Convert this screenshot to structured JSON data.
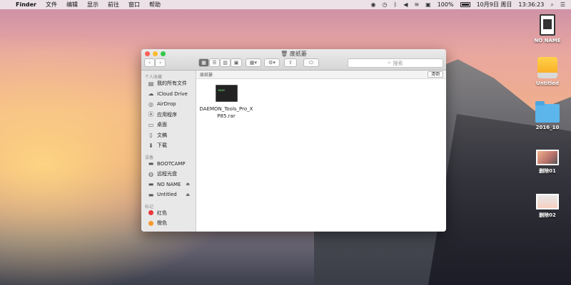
{
  "menubar": {
    "apple": "",
    "app_name": "Finder",
    "menus": [
      "文件",
      "编辑",
      "显示",
      "前往",
      "窗口",
      "帮助"
    ],
    "battery_pct": "100%",
    "date": "10月9日 周日",
    "time": "13:36:23"
  },
  "desktop": {
    "items": [
      "NO NAME",
      "Untitled",
      "2016_10",
      "删除01",
      "删除02"
    ]
  },
  "window": {
    "title": "废纸篓",
    "search_placeholder": "搜索",
    "path_label": "废纸篓",
    "clear_label": "清倒",
    "sidebar": {
      "favorites_header": "个人收藏",
      "favorites": [
        "我的所有文件",
        "iCloud Drive",
        "AirDrop",
        "应用程序",
        "桌面",
        "文稿",
        "下载"
      ],
      "devices_header": "设备",
      "devices": [
        "BOOTCAMP",
        "远程光盘",
        "NO NAME",
        "Untitled"
      ],
      "tags_header": "标记",
      "tags": [
        "红色",
        "橙色"
      ]
    },
    "file": {
      "name": "DAEMON_Tools_Pro_XP85.rar",
      "thumb_text": "exec"
    }
  },
  "colors": {
    "close": "#fc5f57",
    "minimize": "#fdbc2e",
    "zoom": "#34c84a",
    "tag_red": "#e8383a",
    "tag_orange": "#f79a2b",
    "folder_blue": "#5cb6ec"
  }
}
